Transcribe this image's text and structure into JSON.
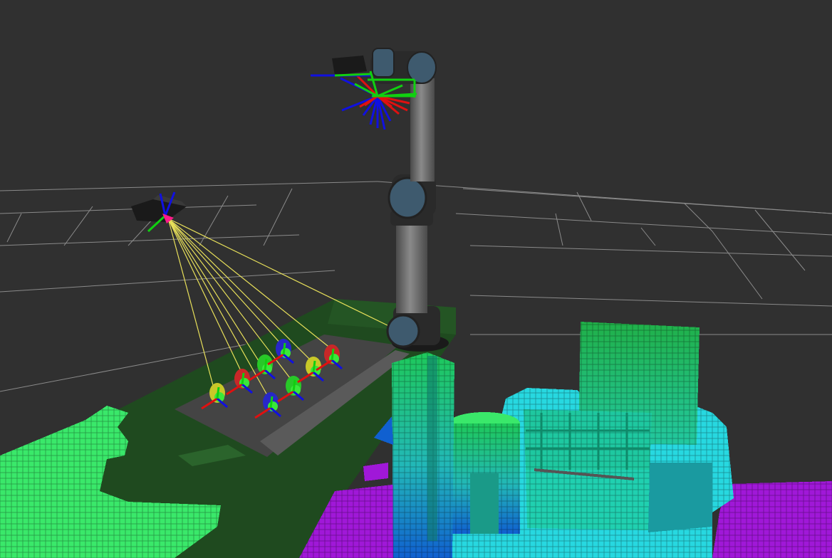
{
  "viewport": {
    "background": "#303030",
    "grid_color": "#a0a0a0"
  },
  "colors": {
    "table_green": "#1f4f1f",
    "tray": "#3a3a3a",
    "ray_yellow": "#e8e05a",
    "robot_gray": "#6c6c6c",
    "robot_joint": "#3c3c3c",
    "cap_blue": "#3e5a6e",
    "voxel_light_green": "#3fe86a",
    "voxel_green": "#1ec85a",
    "voxel_teal": "#22c8a0",
    "voxel_cyan": "#27d8e0",
    "voxel_purple": "#a018d8",
    "voxel_blue": "#1060d0",
    "axis_red": "#e01010",
    "axis_green": "#10d010",
    "axis_blue": "#1010e0"
  },
  "icons": [
    "camera-sensor-icon",
    "ur-robot-arm-icon",
    "tf-axes-icon"
  ]
}
